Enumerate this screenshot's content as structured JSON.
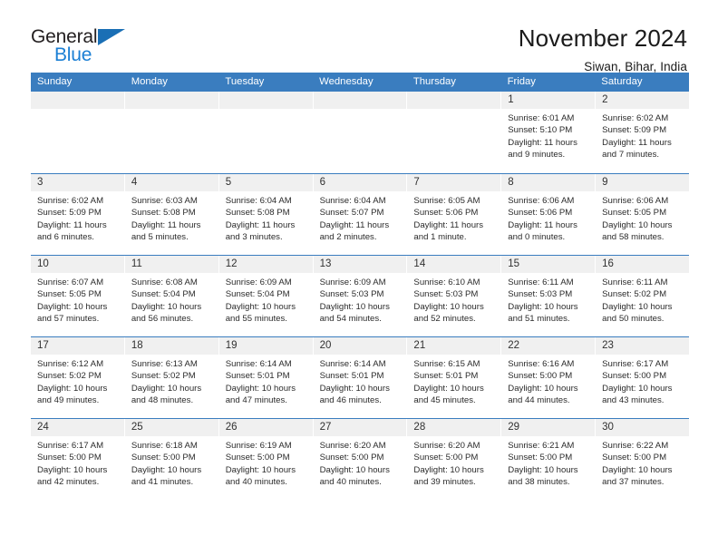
{
  "brand": {
    "name_top": "General",
    "name_bottom": "Blue",
    "triangle_color": "#1a6fb5",
    "blue_text_color": "#1b7fd4"
  },
  "header": {
    "title": "November 2024",
    "location": "Siwan, Bihar, India"
  },
  "colors": {
    "header_row_bg": "#3a7dbf",
    "daynum_bg": "#f0f0f0",
    "row_divider": "#3a7dbf"
  },
  "calendar": {
    "weekdays": [
      "Sunday",
      "Monday",
      "Tuesday",
      "Wednesday",
      "Thursday",
      "Friday",
      "Saturday"
    ],
    "weeks": [
      [
        {
          "day": "",
          "lines": []
        },
        {
          "day": "",
          "lines": []
        },
        {
          "day": "",
          "lines": []
        },
        {
          "day": "",
          "lines": []
        },
        {
          "day": "",
          "lines": []
        },
        {
          "day": "1",
          "lines": [
            "Sunrise: 6:01 AM",
            "Sunset: 5:10 PM",
            "Daylight: 11 hours",
            "and 9 minutes."
          ]
        },
        {
          "day": "2",
          "lines": [
            "Sunrise: 6:02 AM",
            "Sunset: 5:09 PM",
            "Daylight: 11 hours",
            "and 7 minutes."
          ]
        }
      ],
      [
        {
          "day": "3",
          "lines": [
            "Sunrise: 6:02 AM",
            "Sunset: 5:09 PM",
            "Daylight: 11 hours",
            "and 6 minutes."
          ]
        },
        {
          "day": "4",
          "lines": [
            "Sunrise: 6:03 AM",
            "Sunset: 5:08 PM",
            "Daylight: 11 hours",
            "and 5 minutes."
          ]
        },
        {
          "day": "5",
          "lines": [
            "Sunrise: 6:04 AM",
            "Sunset: 5:08 PM",
            "Daylight: 11 hours",
            "and 3 minutes."
          ]
        },
        {
          "day": "6",
          "lines": [
            "Sunrise: 6:04 AM",
            "Sunset: 5:07 PM",
            "Daylight: 11 hours",
            "and 2 minutes."
          ]
        },
        {
          "day": "7",
          "lines": [
            "Sunrise: 6:05 AM",
            "Sunset: 5:06 PM",
            "Daylight: 11 hours",
            "and 1 minute."
          ]
        },
        {
          "day": "8",
          "lines": [
            "Sunrise: 6:06 AM",
            "Sunset: 5:06 PM",
            "Daylight: 11 hours",
            "and 0 minutes."
          ]
        },
        {
          "day": "9",
          "lines": [
            "Sunrise: 6:06 AM",
            "Sunset: 5:05 PM",
            "Daylight: 10 hours",
            "and 58 minutes."
          ]
        }
      ],
      [
        {
          "day": "10",
          "lines": [
            "Sunrise: 6:07 AM",
            "Sunset: 5:05 PM",
            "Daylight: 10 hours",
            "and 57 minutes."
          ]
        },
        {
          "day": "11",
          "lines": [
            "Sunrise: 6:08 AM",
            "Sunset: 5:04 PM",
            "Daylight: 10 hours",
            "and 56 minutes."
          ]
        },
        {
          "day": "12",
          "lines": [
            "Sunrise: 6:09 AM",
            "Sunset: 5:04 PM",
            "Daylight: 10 hours",
            "and 55 minutes."
          ]
        },
        {
          "day": "13",
          "lines": [
            "Sunrise: 6:09 AM",
            "Sunset: 5:03 PM",
            "Daylight: 10 hours",
            "and 54 minutes."
          ]
        },
        {
          "day": "14",
          "lines": [
            "Sunrise: 6:10 AM",
            "Sunset: 5:03 PM",
            "Daylight: 10 hours",
            "and 52 minutes."
          ]
        },
        {
          "day": "15",
          "lines": [
            "Sunrise: 6:11 AM",
            "Sunset: 5:03 PM",
            "Daylight: 10 hours",
            "and 51 minutes."
          ]
        },
        {
          "day": "16",
          "lines": [
            "Sunrise: 6:11 AM",
            "Sunset: 5:02 PM",
            "Daylight: 10 hours",
            "and 50 minutes."
          ]
        }
      ],
      [
        {
          "day": "17",
          "lines": [
            "Sunrise: 6:12 AM",
            "Sunset: 5:02 PM",
            "Daylight: 10 hours",
            "and 49 minutes."
          ]
        },
        {
          "day": "18",
          "lines": [
            "Sunrise: 6:13 AM",
            "Sunset: 5:02 PM",
            "Daylight: 10 hours",
            "and 48 minutes."
          ]
        },
        {
          "day": "19",
          "lines": [
            "Sunrise: 6:14 AM",
            "Sunset: 5:01 PM",
            "Daylight: 10 hours",
            "and 47 minutes."
          ]
        },
        {
          "day": "20",
          "lines": [
            "Sunrise: 6:14 AM",
            "Sunset: 5:01 PM",
            "Daylight: 10 hours",
            "and 46 minutes."
          ]
        },
        {
          "day": "21",
          "lines": [
            "Sunrise: 6:15 AM",
            "Sunset: 5:01 PM",
            "Daylight: 10 hours",
            "and 45 minutes."
          ]
        },
        {
          "day": "22",
          "lines": [
            "Sunrise: 6:16 AM",
            "Sunset: 5:00 PM",
            "Daylight: 10 hours",
            "and 44 minutes."
          ]
        },
        {
          "day": "23",
          "lines": [
            "Sunrise: 6:17 AM",
            "Sunset: 5:00 PM",
            "Daylight: 10 hours",
            "and 43 minutes."
          ]
        }
      ],
      [
        {
          "day": "24",
          "lines": [
            "Sunrise: 6:17 AM",
            "Sunset: 5:00 PM",
            "Daylight: 10 hours",
            "and 42 minutes."
          ]
        },
        {
          "day": "25",
          "lines": [
            "Sunrise: 6:18 AM",
            "Sunset: 5:00 PM",
            "Daylight: 10 hours",
            "and 41 minutes."
          ]
        },
        {
          "day": "26",
          "lines": [
            "Sunrise: 6:19 AM",
            "Sunset: 5:00 PM",
            "Daylight: 10 hours",
            "and 40 minutes."
          ]
        },
        {
          "day": "27",
          "lines": [
            "Sunrise: 6:20 AM",
            "Sunset: 5:00 PM",
            "Daylight: 10 hours",
            "and 40 minutes."
          ]
        },
        {
          "day": "28",
          "lines": [
            "Sunrise: 6:20 AM",
            "Sunset: 5:00 PM",
            "Daylight: 10 hours",
            "and 39 minutes."
          ]
        },
        {
          "day": "29",
          "lines": [
            "Sunrise: 6:21 AM",
            "Sunset: 5:00 PM",
            "Daylight: 10 hours",
            "and 38 minutes."
          ]
        },
        {
          "day": "30",
          "lines": [
            "Sunrise: 6:22 AM",
            "Sunset: 5:00 PM",
            "Daylight: 10 hours",
            "and 37 minutes."
          ]
        }
      ]
    ]
  }
}
